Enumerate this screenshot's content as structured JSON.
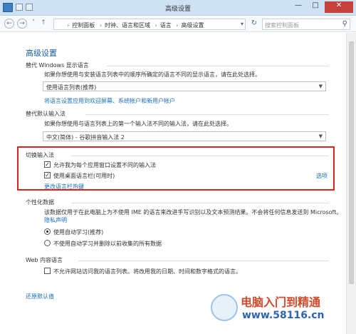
{
  "window": {
    "title": "高级设置",
    "minimize": "—",
    "maximize": "□",
    "close": "✕"
  },
  "nav": {
    "back": "←",
    "forward": "→",
    "down": "˅",
    "up": "↑",
    "breadcrumbs": [
      "控制面板",
      "时钟、语言和区域",
      "语言",
      "高级设置"
    ],
    "search_placeholder": "搜索控制面板"
  },
  "page_title": "高级设置",
  "display_language": {
    "heading": "替代 Windows 显示语言",
    "description": "如果你想使用与安装语言列表中的顺序所确定的语言不同的显示语言，请在此处选择。",
    "selected": "使用语言列表(推荐)",
    "link": "将语言设置应用到欢迎屏幕、系统帐户和新用户帐户"
  },
  "input_method": {
    "heading": "替代默认输入法",
    "description": "如果你想使用与语言列表上的第一个输入法不同的输入法，请在此处选择。",
    "selected": "中文(简体) - 谷歌拼音输入法 2"
  },
  "switch_input": {
    "heading": "切换输入法",
    "options": [
      {
        "label": "允许我为每个应用窗口设置不同的输入法",
        "checked": true
      },
      {
        "label": "使用桌面语言栏(可用时)",
        "checked": true
      }
    ],
    "options_link": "选项",
    "hotkey_link": "更改语言栏热键"
  },
  "personalization": {
    "heading": "个性化数据",
    "description": "该数据仅用于在此电脑上为不使用 IME 的语言来改进手写识别以及文本预测结果。不会将任何信息发送到 Microsoft。",
    "privacy_link": "隐私声明",
    "radios": [
      {
        "label": "使用自动学习(推荐)",
        "selected": true
      },
      {
        "label": "不使用自动学习并删除以前收集的所有数据",
        "selected": false
      }
    ]
  },
  "web_language": {
    "heading": "Web 内容语言",
    "checkbox": {
      "label": "不允许网站访问我的语言列表。将改用我的日期、时间和数字格式的语言。",
      "checked": false
    }
  },
  "restore_link": "还原默认值",
  "watermark": {
    "brand": "电脑入门到精通",
    "url": "www.58116.cn"
  }
}
